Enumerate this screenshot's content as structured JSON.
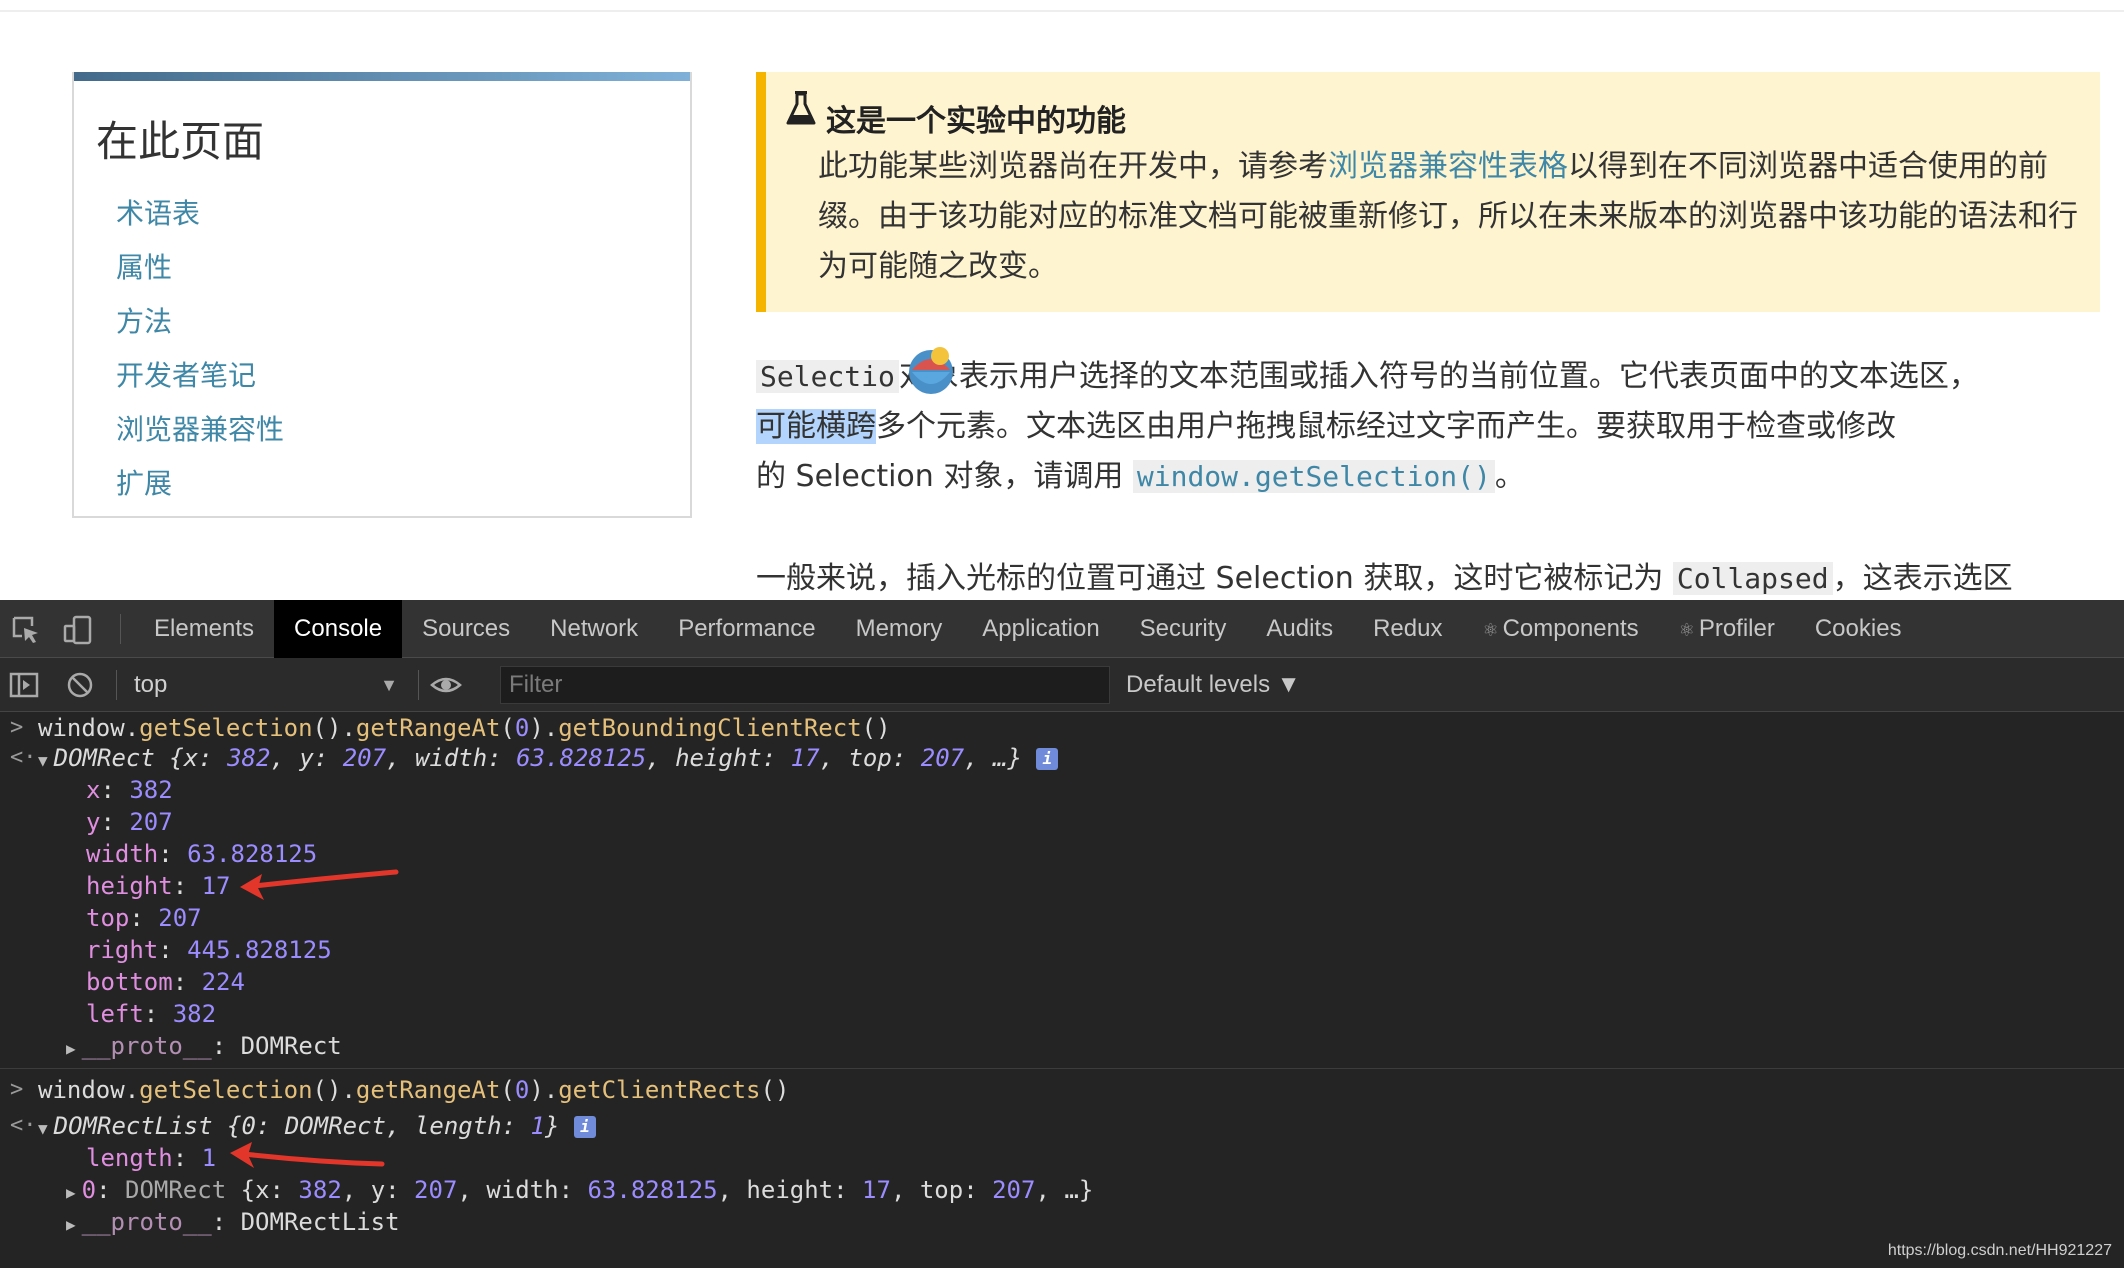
{
  "toc": {
    "title": "在此页面",
    "items": [
      "术语表",
      "属性",
      "方法",
      "开发者笔记",
      "浏览器兼容性",
      "扩展"
    ]
  },
  "note": {
    "title": "这是一个实验中的功能",
    "body_before": "此功能某些浏览器尚在开发中，请参考",
    "body_link": "浏览器兼容性表格",
    "body_after": "以得到在不同浏览器中适合使用的前缀。由于该功能对应的标准文档可能被重新修订，所以在未来版本的浏览器中该功能的语法和行为可能随之改变。"
  },
  "para1": {
    "code_start": "Selectio",
    "text1": "对象表示用户选择的文本范围或插入符号的当前位置。它代表页面中的文本选区，",
    "highlighted": "可能横跨",
    "text2": "多个元素。文本选区由用户拖拽鼠标经过文字而产生。要获取用于检查或修改",
    "text3": "的 Selection 对象，请调用 ",
    "code_link": "window.getSelection()",
    "text4": "。"
  },
  "para2": {
    "text1": "一般来说，插入光标的位置可通过 Selection 获取，这时它被标记为 ",
    "code": "Collapsed",
    "text2": "，这表示选区"
  },
  "devtools": {
    "tabs": [
      "Elements",
      "Console",
      "Sources",
      "Network",
      "Performance",
      "Memory",
      "Application",
      "Security",
      "Audits",
      "Redux",
      "Components",
      "Profiler",
      "Cookies"
    ],
    "active_tab": "Console",
    "context": "top",
    "filter_placeholder": "Filter",
    "levels": "Default levels ▼"
  },
  "console": {
    "cmd1": {
      "obj": "window.",
      "f1": "getSelection",
      "p1": "().",
      "f2": "getRangeAt",
      "p2": "(",
      "arg": "0",
      "p3": ").",
      "f3": "getBoundingClientRect",
      "p4": "()"
    },
    "res1_summary": {
      "type": "DOMRect",
      "open": " {",
      "x_key": "x",
      "x_val": "382",
      "y_key": "y",
      "y_val": "207",
      "w_key": "width",
      "w_val": "63.828125",
      "h_key": "height",
      "h_val": "17",
      "t_key": "top",
      "t_val": "207",
      "end": ", …}"
    },
    "res1_props": [
      {
        "key": "x",
        "value": "382"
      },
      {
        "key": "y",
        "value": "207"
      },
      {
        "key": "width",
        "value": "63.828125"
      },
      {
        "key": "height",
        "value": "17"
      },
      {
        "key": "top",
        "value": "207"
      },
      {
        "key": "right",
        "value": "445.828125"
      },
      {
        "key": "bottom",
        "value": "224"
      },
      {
        "key": "left",
        "value": "382"
      }
    ],
    "res1_proto": {
      "key": "__proto__",
      "value": "DOMRect"
    },
    "cmd2": {
      "obj": "window.",
      "f1": "getSelection",
      "p1": "().",
      "f2": "getRangeAt",
      "p2": "(",
      "arg": "0",
      "p3": ").",
      "f3": "getClientRects",
      "p4": "()"
    },
    "res2_summary": {
      "type": "DOMRectList",
      "open": " {",
      "k0": "0",
      "v0": "DOMRect",
      "len_key": "length",
      "len_val": "1",
      "end": "}"
    },
    "res2_len": {
      "key": "length",
      "value": "1"
    },
    "res2_item": {
      "key": "0",
      "type": "DOMRect",
      "x_val": "382",
      "y_val": "207",
      "w_val": "63.828125",
      "h_val": "17",
      "t_val": "207"
    },
    "res2_proto": {
      "key": "__proto__",
      "value": "DOMRectList"
    },
    "info_glyph": "i",
    "punct": {
      "colon": ": ",
      "comma": ", ",
      "x_label": "x",
      "y_label": "y",
      "width_label": "width",
      "height_label": "height",
      "top_label": "top",
      "ellipsis_end": ", …}",
      "open": " {"
    }
  },
  "watermark": "https://blog.csdn.net/HH921227",
  "colors": {
    "accent_link": "#3f87a6",
    "note_bg": "#fff4d0",
    "note_border": "#f4b400",
    "devtools_bg": "#242424",
    "arrow": "#e2362b"
  }
}
